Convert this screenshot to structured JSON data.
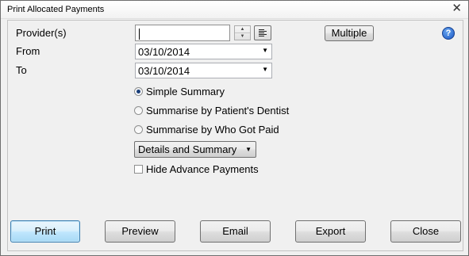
{
  "window": {
    "title": "Print Allocated Payments",
    "close_glyph": "✕"
  },
  "form": {
    "provider_label": "Provider(s)",
    "provider_value": "",
    "multiple_label": "Multiple",
    "from_label": "From",
    "from_value": "03/10/2014",
    "to_label": "To",
    "to_value": "03/10/2014",
    "help_glyph": "?"
  },
  "options": {
    "radios": [
      {
        "label": "Simple Summary",
        "selected": true
      },
      {
        "label": "Summarise by Patient's Dentist",
        "selected": false
      },
      {
        "label": "Summarise by Who Got Paid",
        "selected": false
      }
    ],
    "detail_select": {
      "value": "Details and Summary"
    },
    "hide_advance": {
      "label": "Hide Advance Payments",
      "checked": false
    }
  },
  "buttons": {
    "print": "Print",
    "preview": "Preview",
    "email": "Email",
    "export": "Export",
    "close": "Close"
  },
  "colors": {
    "window_bg": "#f0f0f0",
    "default_button_border": "#3c7fb1",
    "help_icon": "#1a56c4"
  },
  "icons": {
    "close": "close-icon",
    "spin": "spin-arrows-icon",
    "list": "list-icon",
    "dropdown": "chevron-down-icon",
    "help": "help-icon"
  }
}
